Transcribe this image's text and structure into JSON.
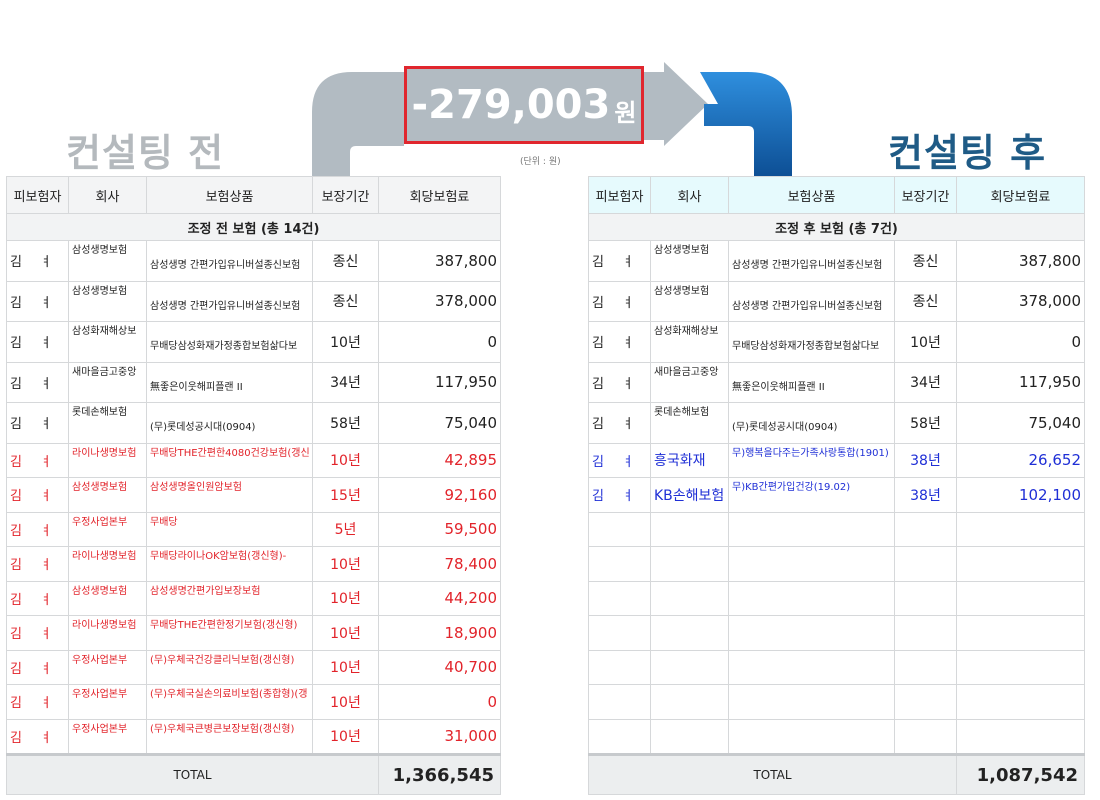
{
  "before": {
    "title": "컨설팅 전",
    "headers": [
      "피보험자",
      "회사",
      "보험상품",
      "보장기간",
      "회당보험료"
    ],
    "subheader": "조정 전 보험 (총 14건)",
    "rows": [
      {
        "name": "김",
        "mid": "ㅕ",
        "company": "삼성생명보험",
        "product": "삼성생명 간편가입유니버설종신보험",
        "period": "종신",
        "premium": "387,800",
        "red": false
      },
      {
        "name": "김",
        "mid": "ㅕ",
        "company": "삼성생명보험",
        "product": "삼성생명 간편가입유니버설종신보험",
        "period": "종신",
        "premium": "378,000",
        "red": false
      },
      {
        "name": "김",
        "mid": "ㅕ",
        "company": "삼성화재해상보",
        "product": "무배당삼성화재가정종합보험삶다보",
        "period": "10년",
        "premium": "0",
        "red": false
      },
      {
        "name": "김",
        "mid": "ㅕ",
        "company": "새마을금고중앙",
        "product": "無좋은이웃해피플랜 II",
        "period": "34년",
        "premium": "117,950",
        "red": false
      },
      {
        "name": "김",
        "mid": "ㅕ",
        "company": "롯데손해보험",
        "product": "(무)롯데성공시대(0904)",
        "period": "58년",
        "premium": "75,040",
        "red": false
      },
      {
        "name": "김",
        "mid": "ㅕ",
        "company": "라이나생명보험",
        "product": "무배당THE간편한4080건강보험(갱신",
        "period": "10년",
        "premium": "42,895",
        "red": true
      },
      {
        "name": "김",
        "mid": "ㅕ",
        "company": "삼성생명보험",
        "product": "삼성생명올인원암보험",
        "period": "15년",
        "premium": "92,160",
        "red": true
      },
      {
        "name": "김",
        "mid": "ㅕ",
        "company": "우정사업본부",
        "product": "무배당",
        "period": "5년",
        "premium": "59,500",
        "red": true
      },
      {
        "name": "김",
        "mid": "ㅕ",
        "company": "라이나생명보험",
        "product": "무배당라이나OK암보험(갱신형)-",
        "period": "10년",
        "premium": "78,400",
        "red": true
      },
      {
        "name": "김",
        "mid": "ㅕ",
        "company": "삼성생명보험",
        "product": "삼성생명간편가입보장보험",
        "period": "10년",
        "premium": "44,200",
        "red": true
      },
      {
        "name": "김",
        "mid": "ㅕ",
        "company": "라이나생명보험",
        "product": "무배당THE간편한정기보험(갱신형)",
        "period": "10년",
        "premium": "18,900",
        "red": true
      },
      {
        "name": "김",
        "mid": "ㅕ",
        "company": "우정사업본부",
        "product": "(무)우체국건강클리닉보험(갱신형)",
        "period": "10년",
        "premium": "40,700",
        "red": true
      },
      {
        "name": "김",
        "mid": "ㅕ",
        "company": "우정사업본부",
        "product": "(무)우체국실손의료비보험(종합형)(갱",
        "period": "10년",
        "premium": "0",
        "red": true
      },
      {
        "name": "김",
        "mid": "ㅕ",
        "company": "우정사업본부",
        "product": "(무)우체국큰병큰보장보험(갱신형)",
        "period": "10년",
        "premium": "31,000",
        "red": true
      }
    ],
    "total_label": "TOTAL",
    "total": "1,366,545"
  },
  "after": {
    "title": "컨설팅 후",
    "headers": [
      "피보험자",
      "회사",
      "보험상품",
      "보장기간",
      "회당보험료"
    ],
    "subheader": "조정 후 보험 (총 7건)",
    "rows": [
      {
        "name": "김",
        "mid": "ㅕ",
        "company": "삼성생명보험",
        "product": "삼성생명 간편가입유니버설종신보험",
        "period": "종신",
        "premium": "387,800",
        "blue": false
      },
      {
        "name": "김",
        "mid": "ㅕ",
        "company": "삼성생명보험",
        "product": "삼성생명 간편가입유니버설종신보험",
        "period": "종신",
        "premium": "378,000",
        "blue": false
      },
      {
        "name": "김",
        "mid": "ㅕ",
        "company": "삼성화재해상보",
        "product": "무배당삼성화재가정종합보험삶다보",
        "period": "10년",
        "premium": "0",
        "blue": false
      },
      {
        "name": "김",
        "mid": "ㅕ",
        "company": "새마을금고중앙",
        "product": "無좋은이웃해피플랜 II",
        "period": "34년",
        "premium": "117,950",
        "blue": false
      },
      {
        "name": "김",
        "mid": "ㅕ",
        "company": "롯데손해보험",
        "product": "(무)롯데성공시대(0904)",
        "period": "58년",
        "premium": "75,040",
        "blue": false
      },
      {
        "name": "김",
        "mid": "ㅕ",
        "company": "흥국화재",
        "product": "무)행복을다주는가족사랑통합(1901)",
        "period": "38년",
        "premium": "26,652",
        "blue": true
      },
      {
        "name": "김",
        "mid": "ㅕ",
        "company": "KB손해보험",
        "product": "무)KB간편가입건강(19.02)",
        "period": "38년",
        "premium": "102,100",
        "blue": true
      }
    ],
    "empty_rows": 7,
    "total_label": "TOTAL",
    "total": "1,087,542"
  },
  "difference": {
    "amount": "-279,003",
    "unit": "원"
  },
  "unit_note": "(단위 : 원)",
  "colors": {
    "before_title": "#b4b9bd",
    "after_title": "#1f5b86",
    "red_text": "#e2232a",
    "blue_text": "#1f2fd6",
    "highlight_border": "#e0262e"
  }
}
